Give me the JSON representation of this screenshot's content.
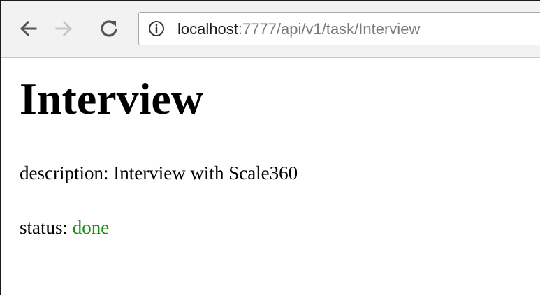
{
  "browser": {
    "url_host": "localhost",
    "url_rest": ":7777/api/v1/task/Interview",
    "icons": {
      "back": "arrow-left-icon",
      "forward": "arrow-right-icon",
      "reload": "reload-icon",
      "info": "info-circle-icon"
    }
  },
  "page": {
    "title": "Interview",
    "description_label": "description:",
    "description_value": "Interview with Scale360",
    "status_label": "status:",
    "status_value": "done"
  },
  "colors": {
    "status_done": "#1b8a1b"
  }
}
